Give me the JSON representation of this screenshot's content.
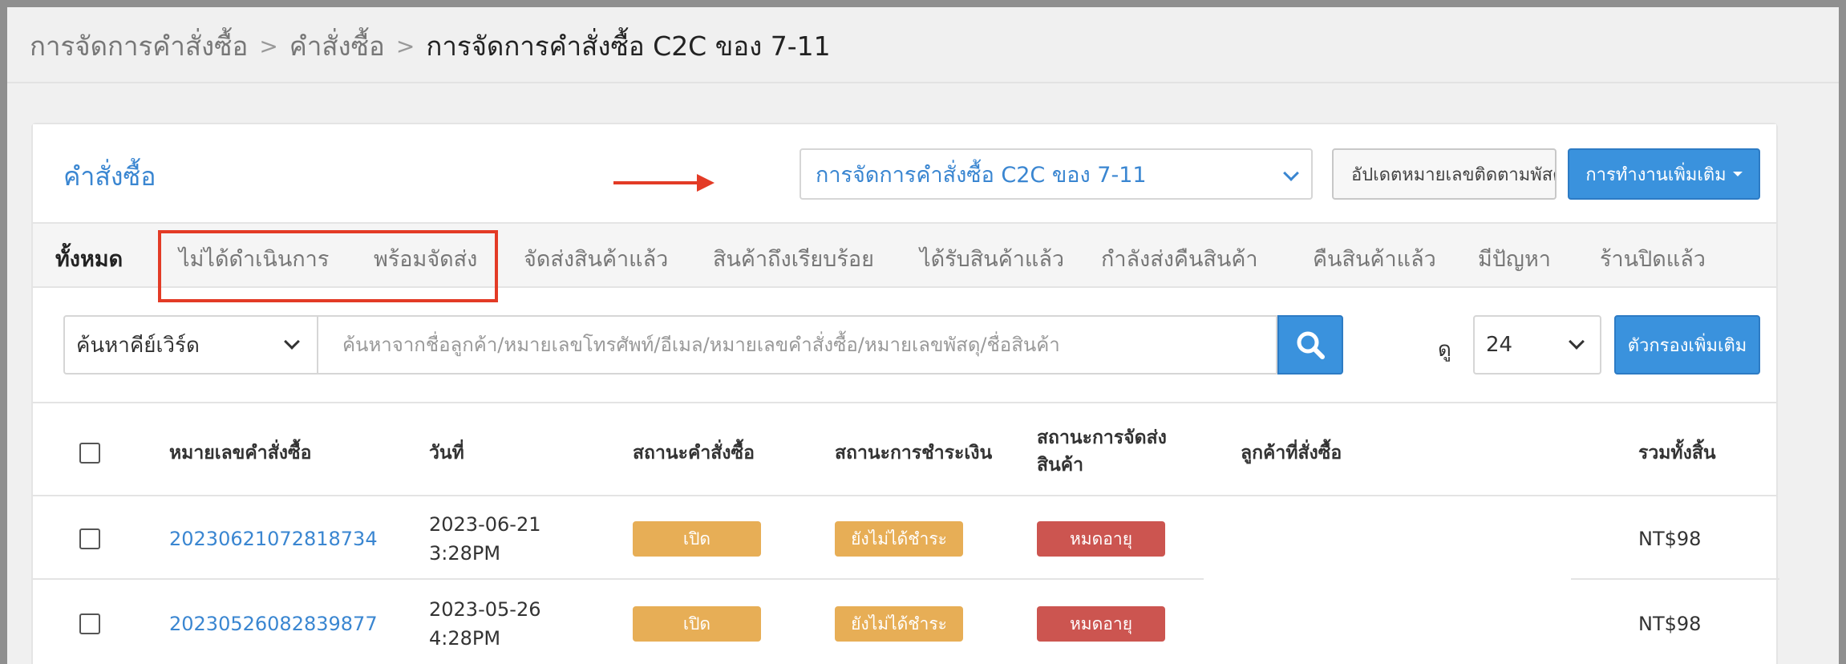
{
  "breadcrumb": {
    "items": [
      "การจัดการคำสั่งซื้อ",
      "คำสั่งซื้อ"
    ],
    "current": "การจัดการคำสั่งซื้อ C2C ของ 7-11",
    "separator": ">"
  },
  "header": {
    "title": "คำสั่งซื้อ",
    "view_select": "การจัดการคำสั่งซื้อ C2C ของ 7-11",
    "update_button": "อัปเดตหมายเลขติดตามพัสดุ",
    "more_actions_button": "การทำงานเพิ่มเติม"
  },
  "tabs": [
    {
      "label": "ทั้งหมด",
      "active": true
    },
    {
      "label": "ไม่ได้ดำเนินการ",
      "active": false
    },
    {
      "label": "พร้อมจัดส่ง",
      "active": false
    },
    {
      "label": "จัดส่งสินค้าแล้ว",
      "active": false
    },
    {
      "label": "สินค้าถึงเรียบร้อย",
      "active": false
    },
    {
      "label": "ได้รับสินค้าแล้ว",
      "active": false
    },
    {
      "label": "กำลังส่งคืนสินค้า",
      "active": false
    },
    {
      "label": "คืนสินค้าแล้ว",
      "active": false
    },
    {
      "label": "มีปัญหา",
      "active": false
    },
    {
      "label": "ร้านปิดแล้ว",
      "active": false
    }
  ],
  "search": {
    "keyword_select": "ค้นหาคีย์เวิร์ด",
    "placeholder": "ค้นหาจากชื่อลูกค้า/หมายเลขโทรศัพท์/อีเมล/หมายเลขคำสั่งซื้อ/หมายเลขพัสดุ/ชื่อสินค้า",
    "value": "",
    "view_label": "ดู",
    "per_page": "24",
    "more_filters_button": "ตัวกรองเพิ่มเติม"
  },
  "table": {
    "headers": {
      "order_number": "หมายเลขคำสั่งซื้อ",
      "date": "วันที่",
      "order_status": "สถานะคำสั่งซื้อ",
      "payment_status": "สถานะการชำระเงิน",
      "shipping_status_line1": "สถานะการจัดส่ง",
      "shipping_status_line2": "สินค้า",
      "customer": "ลูกค้าที่สั่งซื้อ",
      "total": "รวมทั้งสิ้น"
    },
    "rows": [
      {
        "order_number": "20230621072818734",
        "date": "2023-06-21",
        "time": "3:28PM",
        "order_status": "เปิด",
        "payment_status": "ยังไม่ได้ชำระ",
        "shipping_status": "หมดอายุ",
        "customer": "",
        "total": "NT$98"
      },
      {
        "order_number": "20230526082839877",
        "date": "2023-05-26",
        "time": "4:28PM",
        "order_status": "เปิด",
        "payment_status": "ยังไม่ได้ชำระ",
        "shipping_status": "หมดอายุ",
        "customer": "",
        "total": "NT$98"
      }
    ]
  },
  "colors": {
    "accent": "#3a92dd",
    "link": "#3a86d1",
    "annotation": "#e33b26",
    "badge_open": "#e7ae56",
    "badge_expired": "#cc5550"
  }
}
